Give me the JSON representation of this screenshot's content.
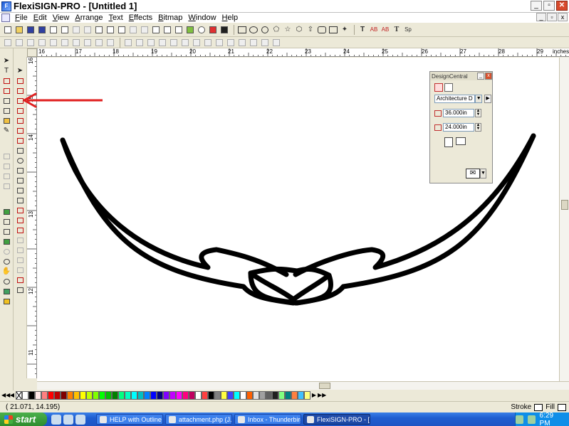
{
  "window": {
    "title": "FlexiSIGN-PRO - [Untitled 1]",
    "controls": {
      "minimize": "_",
      "restore": "▫",
      "close": "✕"
    }
  },
  "menu": [
    "File",
    "Edit",
    "View",
    "Arrange",
    "Text",
    "Effects",
    "Bitmap",
    "Window",
    "Help"
  ],
  "ruler": {
    "units": "inches",
    "h_labels": [
      "16",
      "17",
      "18",
      "19",
      "20",
      "21",
      "22",
      "23",
      "24",
      "25",
      "26",
      "27",
      "28",
      "29"
    ],
    "v_labels": [
      "16",
      "15",
      "14",
      "13",
      "12",
      "11"
    ]
  },
  "design_central": {
    "title": "DesignCentral",
    "preset": "Architecture D",
    "width": "36.000in",
    "height": "24.000in"
  },
  "status": {
    "coords": "( 21.071,     14.195)",
    "stroke_label": "Stroke",
    "fill_label": "Fill"
  },
  "taskbar": {
    "start_label": "start",
    "tasks": [
      {
        "label": "HELP with Outline ...",
        "active": false
      },
      {
        "label": "attachment.php (J...",
        "active": false
      },
      {
        "label": "Inbox - Thunderbird",
        "active": false
      },
      {
        "label": "FlexiSIGN-PRO - [...",
        "active": true
      }
    ],
    "clock": "6:29 PM"
  },
  "palette": [
    "#ffffff",
    "#000000",
    "#ffe8e8",
    "#ff8080",
    "#ff0000",
    "#c00000",
    "#800000",
    "#ff8000",
    "#ffc000",
    "#ffff00",
    "#c0ff00",
    "#80ff00",
    "#00ff00",
    "#00c000",
    "#008000",
    "#00ff80",
    "#00ffc0",
    "#00ffff",
    "#00c0c0",
    "#0080ff",
    "#0000ff",
    "#000080",
    "#8000ff",
    "#c000ff",
    "#ff00ff",
    "#ff0080",
    "#c00060",
    "#ffffff",
    "#ff4040",
    "#000000",
    "#808080",
    "#ffff40",
    "#4040ff",
    "#00ffff",
    "#ffffff",
    "#ff6000",
    "#e0e0e0",
    "#a0a0a0",
    "#606060",
    "#202020",
    "#80ff80",
    "#008080",
    "#ff8040",
    "#40c0ff",
    "#ffff80"
  ],
  "colors": {
    "annotation_arrow": "#e02020",
    "graphic": "#000000"
  }
}
